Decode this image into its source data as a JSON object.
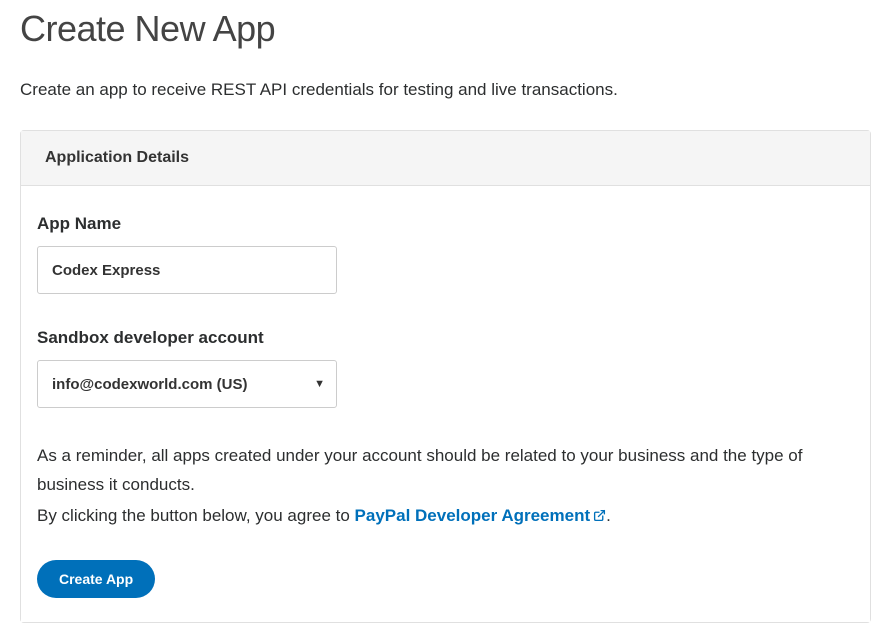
{
  "page": {
    "title": "Create New App",
    "subtitle": "Create an app to receive REST API credentials for testing and live transactions."
  },
  "panel": {
    "header": "Application Details",
    "appName": {
      "label": "App Name",
      "value": "Codex Express"
    },
    "sandboxAccount": {
      "label": "Sandbox developer account",
      "value": "info@codexworld.com (US)"
    },
    "reminder": "As a reminder, all apps created under your account should be related to your business and the type of business it conducts.",
    "agreementPrefix": "By clicking the button below, you agree to ",
    "agreementLink": "PayPal Developer Agreement",
    "agreementSuffix": ".",
    "createButton": "Create App"
  }
}
